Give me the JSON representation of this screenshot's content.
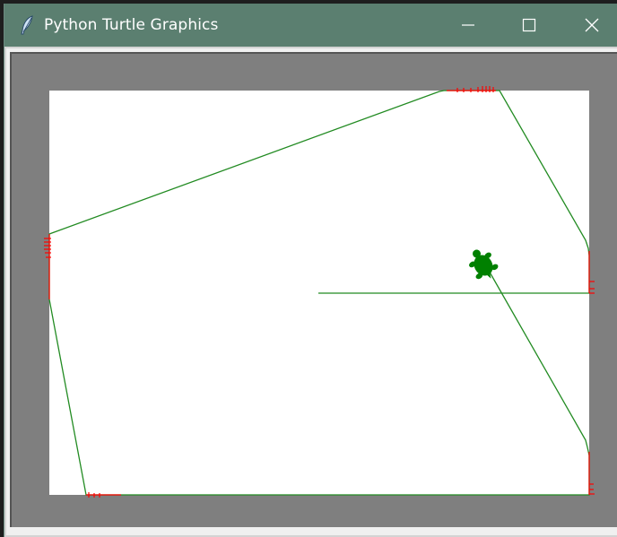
{
  "window": {
    "title": "Python Turtle Graphics",
    "app_icon": "feather-icon",
    "controls": {
      "minimize": "minimize-icon",
      "maximize": "maximize-icon",
      "close": "close-icon"
    }
  },
  "canvas": {
    "background": "#ffffff",
    "frame_color": "#7f7f7f",
    "pen_color": "#228b22",
    "marker_color": "#ff0000",
    "turtle_color": "#008000",
    "turtle_shape": "turtle-icon"
  }
}
